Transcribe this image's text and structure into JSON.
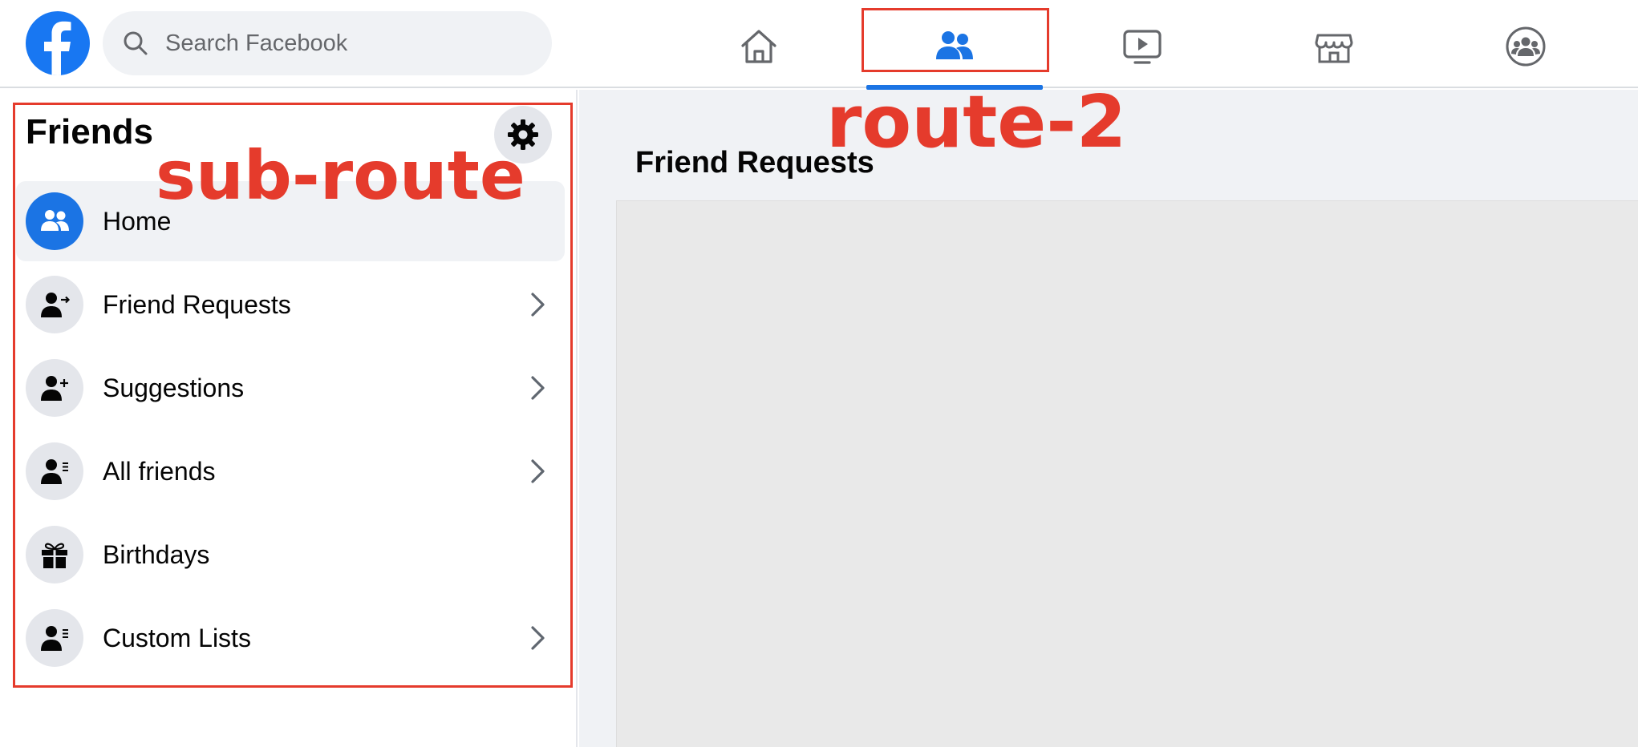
{
  "app": {
    "name": "Facebook"
  },
  "search": {
    "placeholder": "Search Facebook"
  },
  "nav_tabs": [
    {
      "icon": "home-icon"
    },
    {
      "icon": "friends-icon",
      "selected": true
    },
    {
      "icon": "watch-icon"
    },
    {
      "icon": "marketplace-icon"
    },
    {
      "icon": "groups-icon"
    }
  ],
  "sidebar": {
    "title": "Friends",
    "settings_icon": "gear-icon",
    "items": [
      {
        "label": "Home",
        "icon": "friends-icon",
        "active": true,
        "chevron": false
      },
      {
        "label": "Friend Requests",
        "icon": "person-arrow-icon",
        "chevron": true
      },
      {
        "label": "Suggestions",
        "icon": "person-plus-icon",
        "chevron": true
      },
      {
        "label": "All friends",
        "icon": "person-list-icon",
        "chevron": true
      },
      {
        "label": "Birthdays",
        "icon": "gift-icon",
        "chevron": false
      },
      {
        "label": "Custom Lists",
        "icon": "person-list-icon",
        "chevron": true
      }
    ]
  },
  "main": {
    "title": "Friend Requests"
  },
  "annotations": {
    "route_label": "route-2",
    "sub_route_label": "sub-route"
  },
  "colors": {
    "brand": "#1877f2",
    "annotation": "#e53b2c",
    "active_tab": "#1b74e4"
  }
}
